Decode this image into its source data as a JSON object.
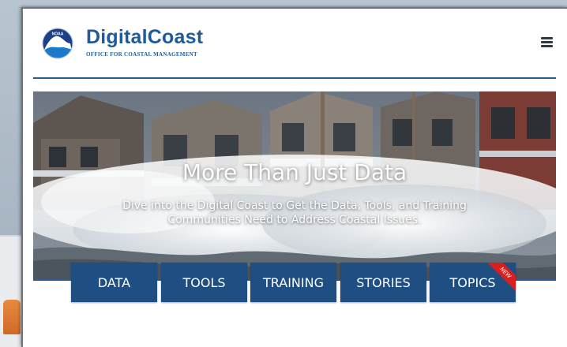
{
  "site": {
    "brand_name": "DigitalCoast",
    "brand_subtitle": "OFFICE FOR COASTAL MANAGEMENT",
    "emblem_text": "NOAA",
    "menu_icon": "hamburger-menu-icon"
  },
  "hero": {
    "title": "More Than Just Data",
    "subtitle": "Dive into the Digital Coast to Get the Data, Tools, and Training Communities Need to Address Coastal Issues."
  },
  "nav": {
    "items": [
      {
        "label": "DATA"
      },
      {
        "label": "TOOLS"
      },
      {
        "label": "TRAINING"
      },
      {
        "label": "STORIES"
      },
      {
        "label": "TOPICS",
        "badge": "NEW"
      }
    ]
  },
  "colors": {
    "brand_blue": "#1f5a9a",
    "nav_blue": "#1f4e82",
    "badge_red": "#d81e1e"
  }
}
